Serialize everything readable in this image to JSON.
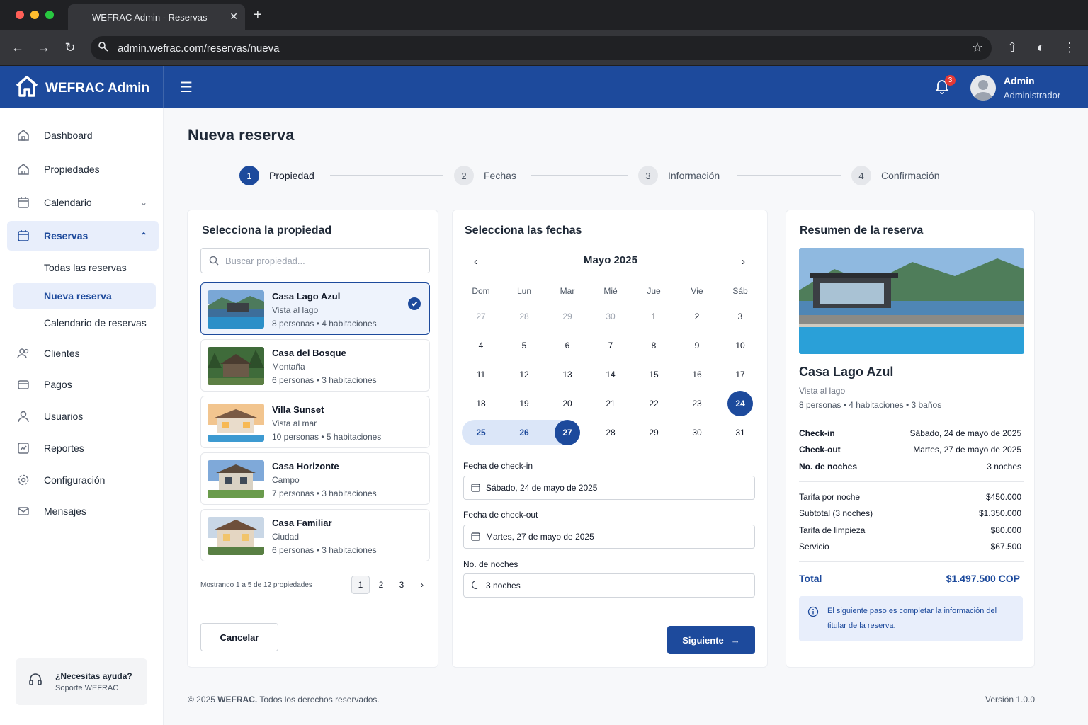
{
  "browser": {
    "tab_title": "WEFRAC Admin - Reservas",
    "url": "admin.wefrac.com/reservas/nueva"
  },
  "header": {
    "brand": "WEFRAC Admin",
    "notifications_count": "3",
    "user_name": "Admin",
    "user_role": "Administrador"
  },
  "sidebar": {
    "items": [
      {
        "label": "Dashboard"
      },
      {
        "label": "Propiedades"
      },
      {
        "label": "Calendario"
      },
      {
        "label": "Reservas"
      },
      {
        "label": "Clientes"
      },
      {
        "label": "Pagos"
      },
      {
        "label": "Usuarios"
      },
      {
        "label": "Reportes"
      },
      {
        "label": "Configuración"
      },
      {
        "label": "Mensajes"
      }
    ],
    "sub_items": [
      {
        "label": "Todas las reservas"
      },
      {
        "label": "Nueva reserva"
      },
      {
        "label": "Calendario de reservas"
      }
    ],
    "help_title": "¿Necesitas ayuda?",
    "help_subtitle": "Soporte WEFRAC"
  },
  "page": {
    "title": "Nueva reserva",
    "steps": [
      {
        "num": "1",
        "label": "Propiedad"
      },
      {
        "num": "2",
        "label": "Fechas"
      },
      {
        "num": "3",
        "label": "Información"
      },
      {
        "num": "4",
        "label": "Confirmación"
      }
    ]
  },
  "properties": {
    "title": "Selecciona la propiedad",
    "search_placeholder": "Buscar propiedad...",
    "list": [
      {
        "name": "Casa Lago Azul",
        "location": "Vista al lago",
        "capacity": "8 personas • 4 habitaciones"
      },
      {
        "name": "Casa del Bosque",
        "location": "Montaña",
        "capacity": "6 personas • 3 habitaciones"
      },
      {
        "name": "Villa Sunset",
        "location": "Vista al mar",
        "capacity": "10 personas • 5 habitaciones"
      },
      {
        "name": "Casa Horizonte",
        "location": "Campo",
        "capacity": "7 personas • 3 habitaciones"
      },
      {
        "name": "Casa Familiar",
        "location": "Ciudad",
        "capacity": "6 personas • 3 habitaciones"
      }
    ],
    "pagination_info": "Mostrando 1 a 5 de 12 propiedades",
    "pages": [
      "1",
      "2",
      "3"
    ],
    "cancel_label": "Cancelar"
  },
  "calendar": {
    "title": "Selecciona las fechas",
    "month": "Mayo 2025",
    "weekdays": [
      "Dom",
      "Lun",
      "Mar",
      "Mié",
      "Jue",
      "Vie",
      "Sáb"
    ],
    "weeks": [
      [
        "27",
        "28",
        "29",
        "30",
        "1",
        "2",
        "3"
      ],
      [
        "4",
        "5",
        "6",
        "7",
        "8",
        "9",
        "10"
      ],
      [
        "11",
        "12",
        "13",
        "14",
        "15",
        "16",
        "17"
      ],
      [
        "18",
        "19",
        "20",
        "21",
        "22",
        "23",
        "24"
      ],
      [
        "25",
        "26",
        "27",
        "28",
        "29",
        "30",
        "31"
      ]
    ],
    "checkin_label": "Fecha de check-in",
    "checkin_value": "Sábado, 24 de mayo de 2025",
    "checkout_label": "Fecha de check-out",
    "checkout_value": "Martes, 27 de mayo de 2025",
    "nights_label": "No. de noches",
    "nights_value": "3 noches",
    "next_label": "Siguiente"
  },
  "summary": {
    "title": "Resumen de la reserva",
    "property_name": "Casa Lago Azul",
    "location": "Vista al lago",
    "details": "8 personas • 4 habitaciones • 3 baños",
    "checkin_label": "Check-in",
    "checkin_value": "Sábado, 24 de mayo de 2025",
    "checkout_label": "Check-out",
    "checkout_value": "Martes, 27 de mayo de 2025",
    "nights_label": "No. de noches",
    "nights_value": "3 noches",
    "rate_label": "Tarifa por noche",
    "rate_value": "$450.000",
    "subtotal_label": "Subtotal (3 noches)",
    "subtotal_value": "$1.350.000",
    "cleaning_label": "Tarifa de limpieza",
    "cleaning_value": "$80.000",
    "service_label": "Servicio",
    "service_value": "$67.500",
    "total_label": "Total",
    "total_value": "$1.497.500 COP",
    "info_text": "El siguiente paso es completar la información del titular de la reserva."
  },
  "footer": {
    "copyright_prefix": "© 2025 ",
    "copyright_brand": "WEFRAC.",
    "copyright_suffix": " Todos los derechos reservados.",
    "version": "Versión 1.0.0"
  },
  "colors": {
    "primary": "#1d4a9c",
    "notification": "#e53935"
  }
}
